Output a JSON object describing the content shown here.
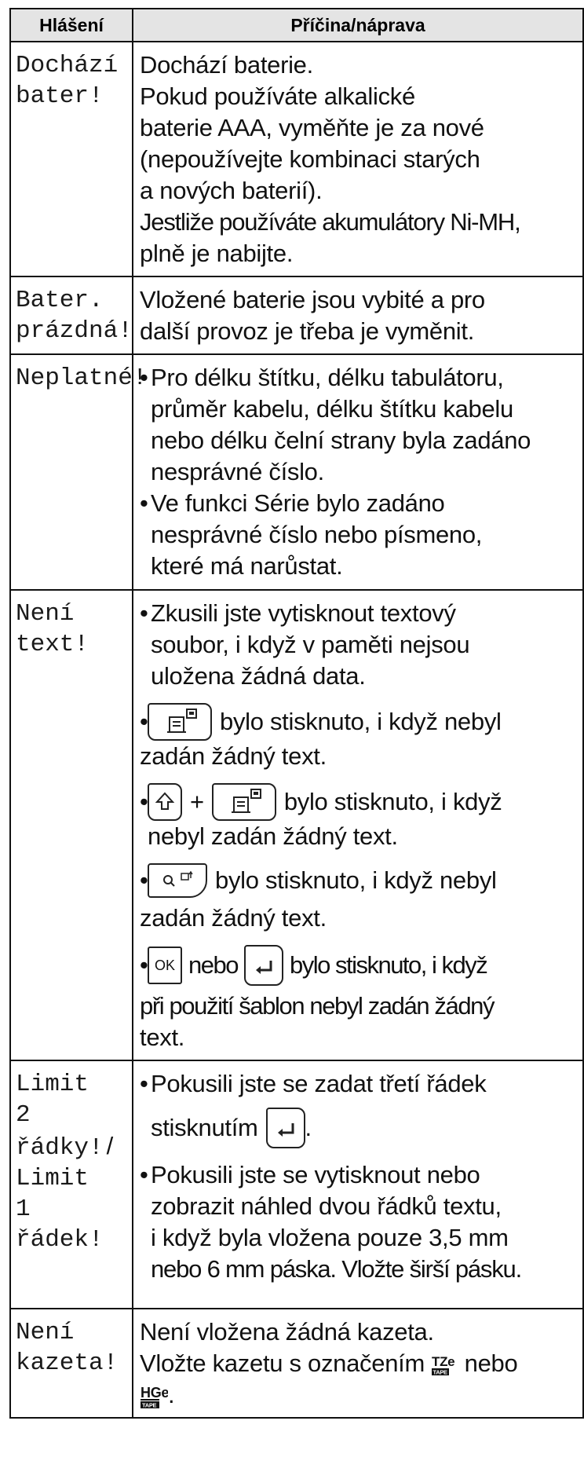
{
  "table": {
    "headers": [
      "Hlášení",
      "Příčina/náprava"
    ],
    "rows": [
      {
        "message_lines": [
          "Dochází",
          "bater!"
        ],
        "lines": [
          "Dochází baterie.",
          "Pokud používáte alkalické",
          "baterie AAA, vyměňte je za nové",
          "(nepoužívejte kombinaci starých",
          "a nových baterií).",
          "Jestliže používáte akumulátory Ni-MH,",
          "plně je nabijte."
        ]
      },
      {
        "message_lines": [
          "Bater.",
          "prázdná!"
        ],
        "lines": [
          "Vložené baterie jsou vybité a pro",
          "další provoz je třeba je vyměnit."
        ]
      },
      {
        "message_lines": [
          "Neplatné!"
        ],
        "bullets": [
          {
            "lines": [
              "Pro délku štítku, délku tabulátoru,",
              "průměr kabelu, délku štítku kabelu",
              "nebo délku čelní strany byla zadáno",
              "nesprávné číslo."
            ]
          },
          {
            "lines": [
              "Ve funkci Série bylo zadáno",
              "nesprávné číslo nebo písmeno,",
              "které má narůstat."
            ]
          }
        ]
      },
      {
        "message_lines": [
          "Není",
          "text!"
        ],
        "bullet1": [
          "Zkusili jste vytisknout textový",
          "soubor, i když v paměti nejsou",
          "uložena žádná data."
        ],
        "bullet2": {
          "after_key": "bylo stisknuto, i když nebyl",
          "line2": "zadán žádný text."
        },
        "bullet3": {
          "plus": "+",
          "after_key": "bylo stisknuto, i když",
          "line2": "nebyl zadán žádný text."
        },
        "bullet4": {
          "after_key": "bylo stisknuto, i když nebyl",
          "line2": "zadán žádný text."
        },
        "bullet5": {
          "ok_label": "OK",
          "mid": "nebo",
          "after_key": "bylo stisknuto, i když",
          "line2": "při použití šablon nebyl zadán žádný",
          "line3": "text."
        }
      },
      {
        "message_lines": [
          "Limit",
          "2 řádky!",
          "Limit",
          "1 řádek!"
        ],
        "slash": "/",
        "bullet1": {
          "line1": "Pokusili jste se zadat třetí řádek",
          "before_key": "stisknutím",
          "after_key": "."
        },
        "bullet2": [
          "Pokusili jste se vytisknout nebo",
          "zobrazit náhled dvou řádků textu,",
          "i když byla vložena pouze 3,5 mm",
          "nebo 6 mm páska. Vložte širší pásku."
        ]
      },
      {
        "message_lines": [
          "Není",
          "kazeta!"
        ],
        "line1": "Není vložena žádná kazeta.",
        "line2_before": "Vložte kazetu s označením",
        "line2_mid": "nebo",
        "line3_after": ".",
        "logo_tz": "TZe",
        "logo_hg": "HGe",
        "logo_tape": "TAPE"
      }
    ]
  },
  "icons": [
    "print-key-icon",
    "shift-key-icon",
    "preview-key-icon",
    "ok-key-icon",
    "enter-key-icon",
    "tze-tape-logo",
    "hge-tape-logo"
  ]
}
